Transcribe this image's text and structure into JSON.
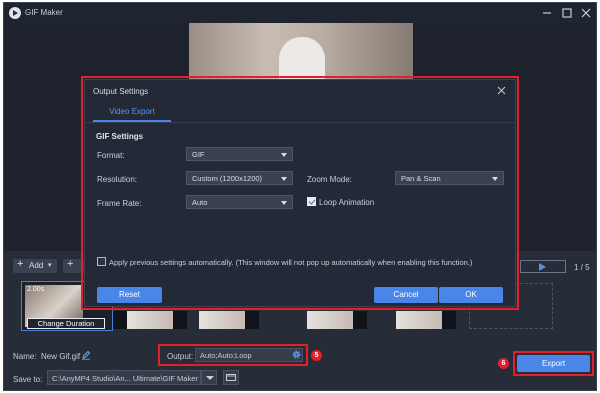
{
  "app": {
    "title": "GIF Maker"
  },
  "toolbar": {
    "add_label": "Add",
    "page_count": "1 / 5"
  },
  "clip": {
    "duration": "2.00s",
    "change_duration_label": "Change Duration"
  },
  "bottom": {
    "name_label": "Name:",
    "name_value": "New Gif.gif",
    "output_label": "Output:",
    "output_value": "Auto;Auto;Loop",
    "output_badge": "5",
    "save_label": "Save to:",
    "save_path": "C:\\AnyMP4 Studio\\An... Ultimate\\GIF Maker",
    "export_label": "Export",
    "export_badge": "6"
  },
  "dialog": {
    "title": "Output Settings",
    "tab": "Video Export",
    "section": "GIF Settings",
    "format_label": "Format:",
    "format_value": "GIF",
    "resolution_label": "Resolution:",
    "resolution_value": "Custom (1200x1200)",
    "zoom_label": "Zoom Mode:",
    "zoom_value": "Pan & Scan",
    "framerate_label": "Frame Rate:",
    "framerate_value": "Auto",
    "loop_label": "Loop Animation",
    "loop_checked": true,
    "apply_text": "Apply previous settings automatically. (This window will not pop up automatically when enabling this function.)",
    "apply_checked": false,
    "reset_label": "Reset",
    "cancel_label": "Cancel",
    "ok_label": "OK"
  },
  "colors": {
    "accent": "#4a86e8",
    "highlight": "#e3202a",
    "background": "#262c38"
  },
  "icons": [
    "app-logo-icon",
    "minimize-icon",
    "maximize-icon",
    "close-icon",
    "plus-icon",
    "play-icon",
    "edit-icon",
    "gear-icon",
    "folder-icon",
    "chevron-down-icon",
    "dialog-close-icon"
  ]
}
